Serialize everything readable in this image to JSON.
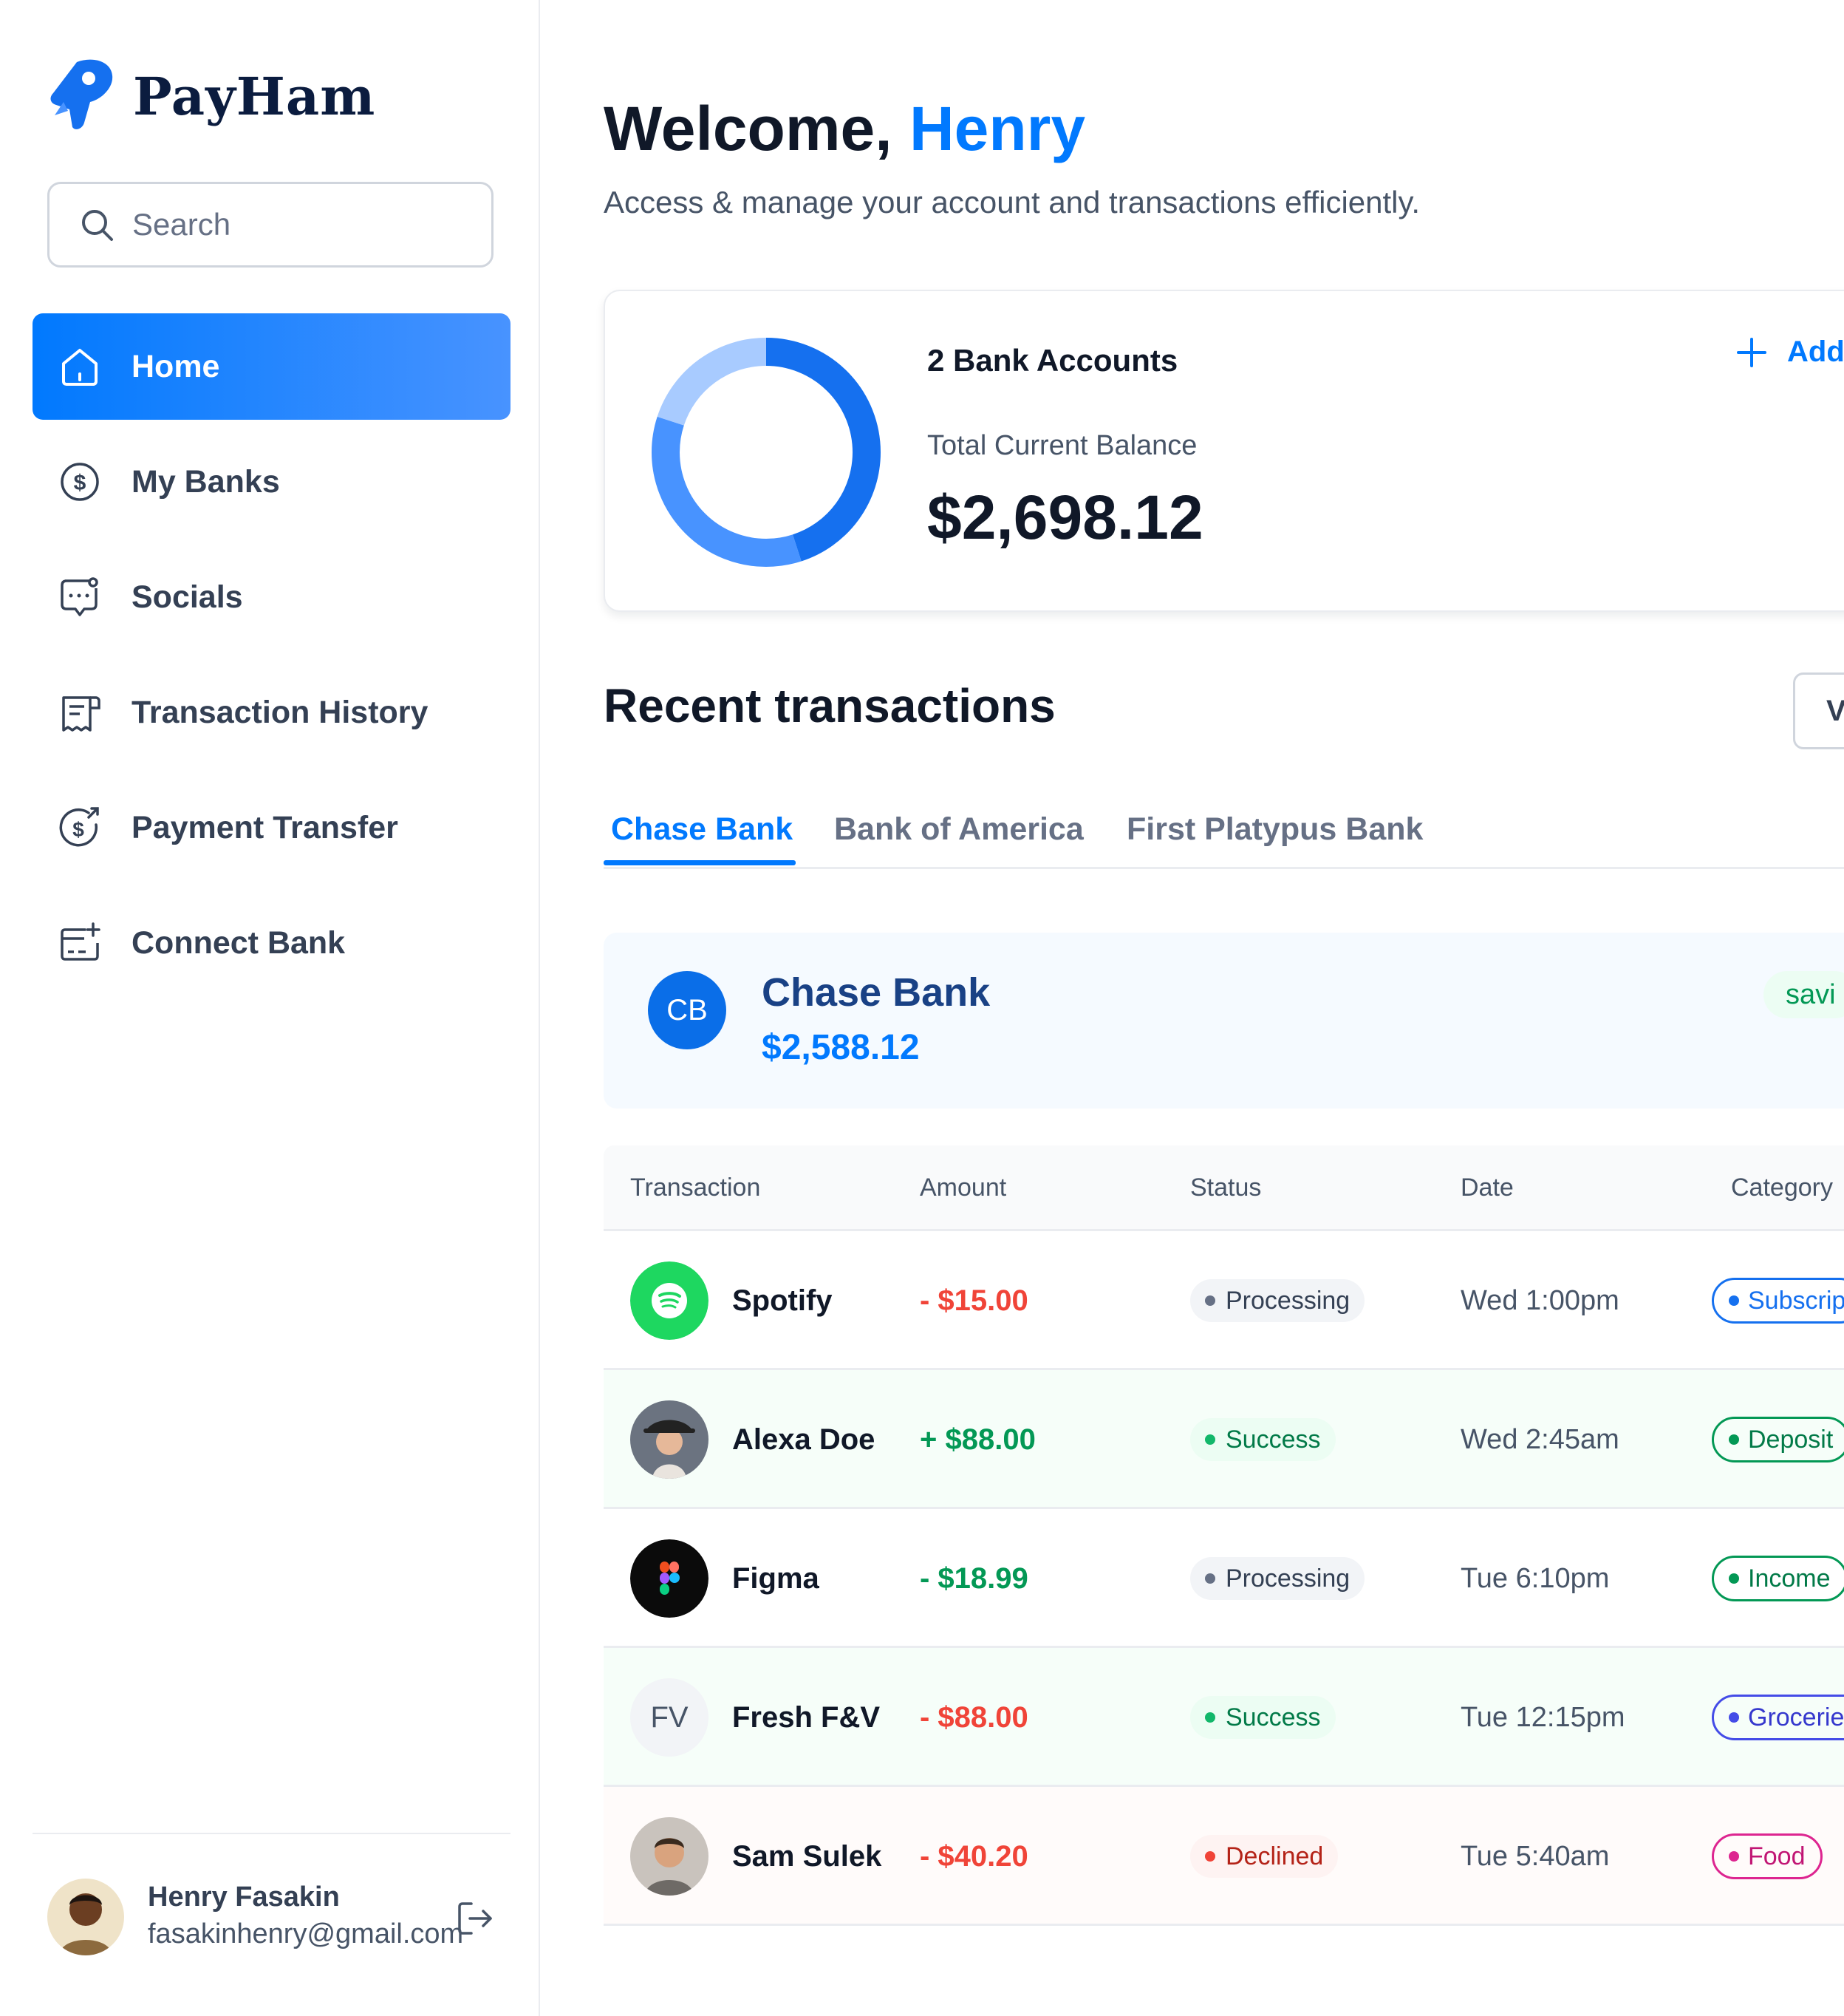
{
  "app": {
    "name": "PayHam"
  },
  "search": {
    "placeholder": "Search"
  },
  "sidebar": {
    "items": [
      {
        "label": "Home",
        "icon": "home-icon",
        "active": true
      },
      {
        "label": "My Banks",
        "icon": "dollar-circle-icon"
      },
      {
        "label": "Socials",
        "icon": "chat-icon"
      },
      {
        "label": "Transaction History",
        "icon": "receipt-icon"
      },
      {
        "label": "Payment Transfer",
        "icon": "money-send-icon"
      },
      {
        "label": "Connect Bank",
        "icon": "card-add-icon"
      }
    ]
  },
  "user": {
    "name": "Henry Fasakin",
    "email": "fasakinhenry@gmail.com"
  },
  "header": {
    "greeting": "Welcome,",
    "name": "Henry",
    "subtitle": "Access & manage your account and transactions efficiently."
  },
  "balance": {
    "accounts_label": "2 Bank Accounts",
    "total_label": "Total Current Balance",
    "total_value": "$2,698.12",
    "add_label": "Add"
  },
  "donut": {
    "segments": [
      {
        "share": 0.45,
        "color": "#1570ef"
      },
      {
        "share": 0.35,
        "color": "#4893ff"
      },
      {
        "share": 0.2,
        "color": "#a8cbff"
      }
    ],
    "track_color": "#e8f1ff"
  },
  "recent": {
    "title": "Recent transactions",
    "view_all": "V"
  },
  "tabs": [
    {
      "label": "Chase Bank",
      "active": true
    },
    {
      "label": "Bank of America"
    },
    {
      "label": "First Platypus Bank"
    }
  ],
  "bank_card": {
    "initials": "CB",
    "name": "Chase Bank",
    "balance": "$2,588.12",
    "type": "savi"
  },
  "table": {
    "headers": [
      "Transaction",
      "Amount",
      "Status",
      "Date",
      "Category"
    ],
    "rows": [
      {
        "name": "Spotify",
        "logo": "spotify-logo",
        "amount": "- $15.00",
        "amount_color": "#f04438",
        "status": "Processing",
        "date": "Wed 1:00pm",
        "category": "Subscrip",
        "category_color": "#1570ef",
        "row": "plain"
      },
      {
        "name": "Alexa Doe",
        "logo": "alexa-avatar",
        "amount": "+ $88.00",
        "amount_color": "#039855",
        "status": "Success",
        "date": "Wed 2:45am",
        "category": "Deposit",
        "category_color": "#039855",
        "row": "green"
      },
      {
        "name": "Figma",
        "logo": "figma-logo",
        "amount": "- $18.99",
        "amount_color": "#039855",
        "status": "Processing",
        "date": "Tue 6:10pm",
        "category": "Income",
        "category_color": "#039855",
        "row": "plain"
      },
      {
        "name": "Fresh F&V",
        "logo": "FV",
        "amount": "- $88.00",
        "amount_color": "#f04438",
        "status": "Success",
        "date": "Tue 12:15pm",
        "category": "Groceries",
        "category_color": "#444ce7",
        "row": "green"
      },
      {
        "name": "Sam Sulek",
        "logo": "sam-avatar",
        "amount": "- $40.20",
        "amount_color": "#f04438",
        "status": "Declined",
        "date": "Tue 5:40am",
        "category": "Food",
        "category_color": "#dd2590",
        "row": "red"
      }
    ]
  },
  "colors": {
    "accent": "#0179fe",
    "sidebar_active_start": "#0179fe",
    "sidebar_active_end": "#4893ff"
  }
}
